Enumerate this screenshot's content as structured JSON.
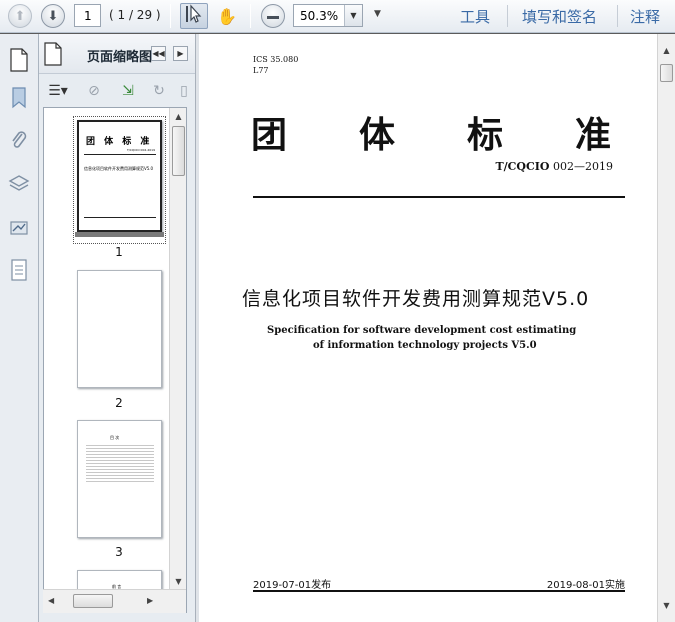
{
  "toolbar": {
    "current_page": "1",
    "page_count": "( 1 / 29 )",
    "zoom": "50.3%",
    "links": [
      "工具",
      "填写和签名",
      "注释"
    ]
  },
  "icons": {
    "prev_page": "up-arrow-icon",
    "next_page": "down-arrow-icon",
    "select_tool": "select-cursor-icon",
    "hand_tool": "hand-icon",
    "zoom_out": "minus-icon"
  },
  "panel": {
    "title": "页面缩略图"
  },
  "thumbnails": [
    {
      "label": "1",
      "heading": "团  体  标  准",
      "code": "T/CQCIO 002-2019",
      "doc_title": "信息化项目软件开发费用测算规范V5.0"
    },
    {
      "label": "2"
    },
    {
      "label": "3",
      "heading": "目  次"
    },
    {
      "label": "",
      "heading": "前  言"
    }
  ],
  "document": {
    "ics": "ICS 35.080",
    "ccs": "L77",
    "heading": [
      "团",
      "体",
      "标",
      "准"
    ],
    "standard_no_prefix": "T/CQCIO",
    "standard_no": " 002—2019",
    "title_cn": "信息化项目软件开发费用测算规范V5.0",
    "title_en_1": "Specification for software development cost estimating",
    "title_en_2": "of information technology projects V5.0",
    "publish_date": "2019-07-01发布",
    "implement_date": "2019-08-01实施"
  },
  "colors": {
    "toolbar_link": "#3a6aa6",
    "panel_bg": "#e7ecf1",
    "page_bg": "#ffffff"
  }
}
